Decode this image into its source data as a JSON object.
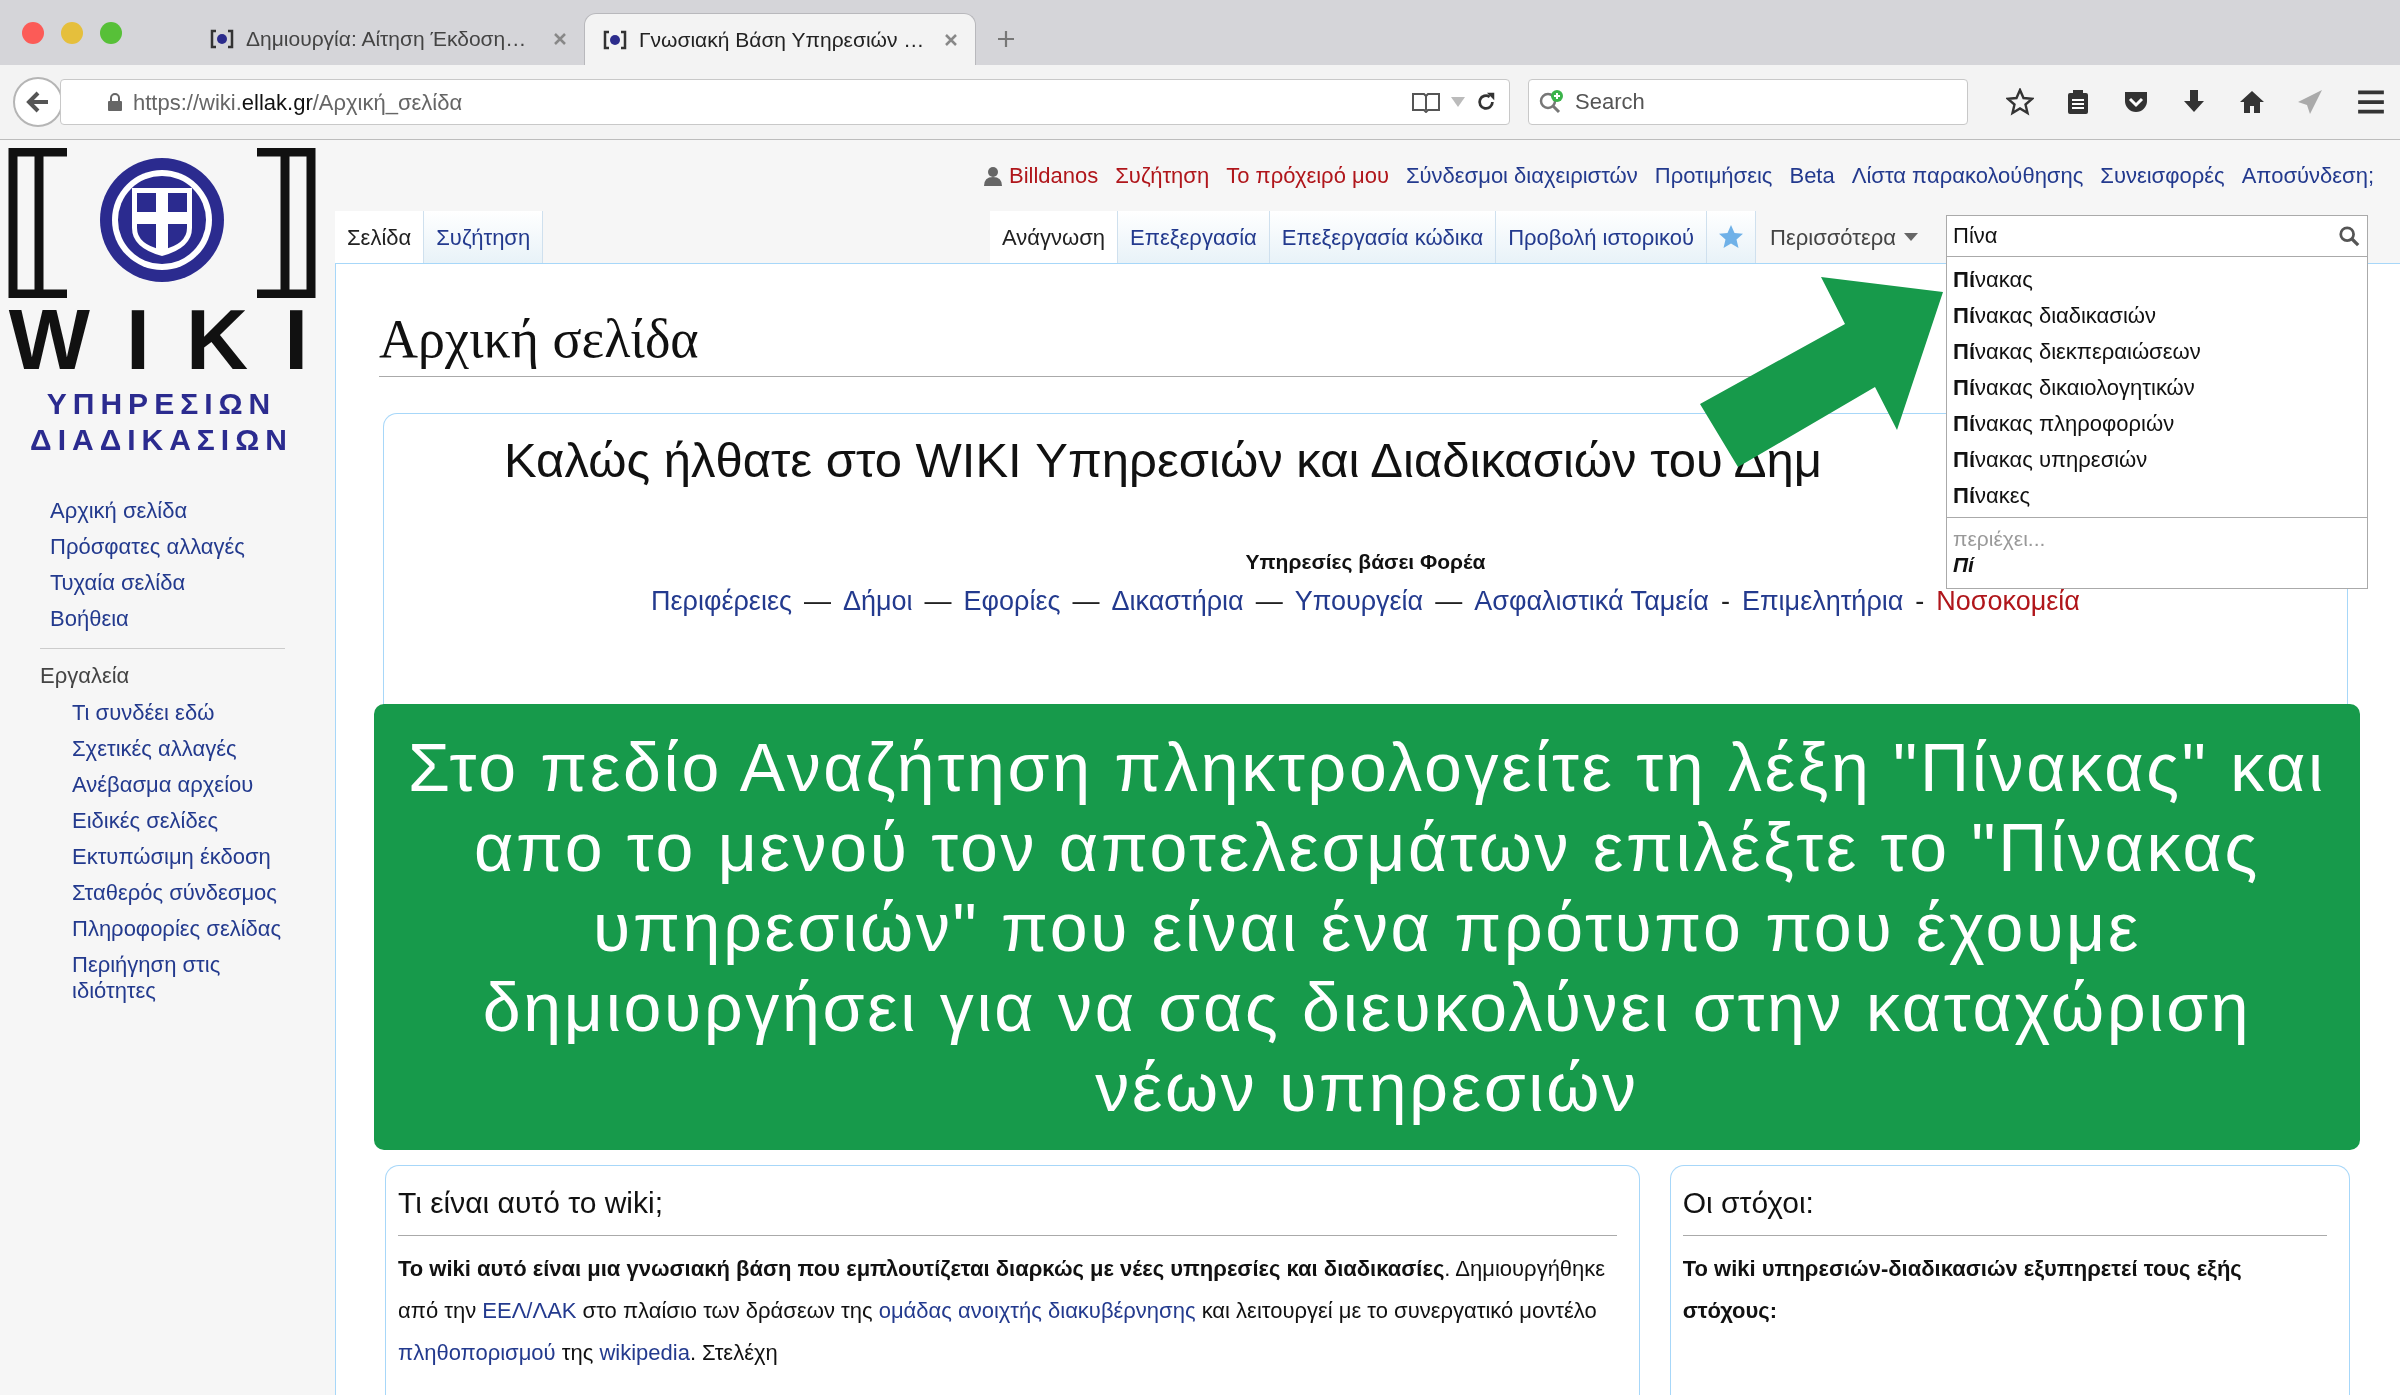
{
  "browser": {
    "tabs": [
      {
        "title": "Δημιουργία: Αίτηση Έκδοση…",
        "selected": false
      },
      {
        "title": "Γνωσιακή Βάση Υπηρεσιών …",
        "selected": true
      }
    ],
    "url_host": "https://wiki.",
    "url_domain": "ellak.gr",
    "url_path": "/Αρχική_σελίδα",
    "search_placeholder": "Search"
  },
  "logo": {
    "word": "WIKI",
    "line_1": "ΥΠΗΡΕΣΙΩΝ",
    "line_2": "ΔΙΑΔΙΚΑΣΙΩΝ"
  },
  "sidebar": {
    "navigation": [
      "Αρχική σελίδα",
      "Πρόσφατες αλλαγές",
      "Τυχαία σελίδα",
      "Βοήθεια"
    ],
    "tools_heading": "Εργαλεία",
    "tools": [
      "Τι συνδέει εδώ",
      "Σχετικές αλλαγές",
      "Ανέβασμα αρχείου",
      "Ειδικές σελίδες",
      "Εκτυπώσιμη έκδοση",
      "Σταθερός σύνδεσμος",
      "Πληροφορίες σελίδας",
      "Περιήγηση στις ιδιότητες"
    ]
  },
  "personal_links": [
    {
      "label": "Billdanos",
      "kind": "user",
      "missing": true
    },
    {
      "label": "Συζήτηση",
      "kind": "link",
      "missing": true
    },
    {
      "label": "Το πρόχειρό μου",
      "kind": "link",
      "missing": true
    },
    {
      "label": "Σύνδεσμοι διαχειριστών",
      "kind": "link",
      "missing": false
    },
    {
      "label": "Προτιμήσεις",
      "kind": "link",
      "missing": false
    },
    {
      "label": "Beta",
      "kind": "link",
      "missing": false
    },
    {
      "label": "Λίστα παρακολούθησης",
      "kind": "link",
      "missing": false
    },
    {
      "label": "Συνεισφορές",
      "kind": "link",
      "missing": false
    },
    {
      "label": "Αποσύνδεση;",
      "kind": "link",
      "missing": false
    }
  ],
  "namespace_tabs": [
    {
      "label": "Σελίδα",
      "selected": true
    },
    {
      "label": "Συζήτηση",
      "selected": false
    }
  ],
  "view_tabs": [
    {
      "label": "Ανάγνωση",
      "selected": true
    },
    {
      "label": "Επεξεργασία",
      "selected": false
    },
    {
      "label": "Επεξεργασία κώδικα",
      "selected": false
    },
    {
      "label": "Προβολή ιστορικού",
      "selected": false
    }
  ],
  "more_menu": "Περισσότερα",
  "search": {
    "value": "Πίνα",
    "suggestions": [
      "**Πί**νακας",
      "**Πί**νακας διαδικασιών",
      "**Πί**νακας διεκπεραιώσεων",
      "**Πί**νακας δικαιολογητικών",
      "**Πί**νακας πληροφοριών",
      "**Πί**νακας υπηρεσιών",
      "**Πί**νακες"
    ],
    "contains_label": "περιέχει...",
    "contains_value": "Πί"
  },
  "heading": "Αρχική σελίδα",
  "welcome": {
    "title": "Καλώς ήλθατε στο WIKI Υπηρεσιών και Διαδικασιών του Δημ",
    "subtitle": "Υπηρεσίες βάσει Φορέα",
    "links": [
      {
        "label": "Περιφέρειες",
        "missing": false,
        "separator": "—"
      },
      {
        "label": "Δήμοι",
        "missing": false,
        "separator": "—"
      },
      {
        "label": "Εφορίες",
        "missing": false,
        "separator": "—"
      },
      {
        "label": "Δικαστήρια",
        "missing": false,
        "separator": "—"
      },
      {
        "label": "Υπουργεία",
        "missing": false,
        "separator": "—"
      },
      {
        "label": "Ασφαλιστικά Ταμεία",
        "missing": false,
        "separator": "-"
      },
      {
        "label": "Επιμελητήρια",
        "missing": false,
        "separator": "-"
      },
      {
        "label": "Νοσοκομεία",
        "missing": true
      }
    ]
  },
  "annotation": "Στο πεδίο Αναζήτηση πληκτρολογείτε τη λέξη \"Πίνακας\" και απο το μενού τον αποτελεσμάτων επιλέξτε το \"Πίνακας υπηρεσιών\" που είναι ένα πρότυπο που έχουμε δημιουργήσει για να σας διευκολύνει στην καταχώριση νέων υπηρεσιών",
  "boxes": [
    {
      "title": "Τι είναι αυτό το wiki;",
      "paragraph": [
        {
          "kind": "bold",
          "text": "Το wiki αυτό είναι μια γνωσιακή βάση που εμπλουτίζεται διαρκώς με νέες υπηρεσίες και διαδικασίες"
        },
        {
          "kind": "text",
          "text": ". Δημιουργήθηκε από την "
        },
        {
          "kind": "link",
          "text": "ΕΕΛ/ΛΑΚ"
        },
        {
          "kind": "text",
          "text": " στο πλαίσιο των δράσεων της "
        },
        {
          "kind": "link",
          "text": "ομάδας ανοιχτής διακυβέρνησης"
        },
        {
          "kind": "text",
          "text": " και λειτουργεί με το συνεργατικό μοντέλο "
        },
        {
          "kind": "link",
          "text": "πληθοπορισμού"
        },
        {
          "kind": "text",
          "text": " της "
        },
        {
          "kind": "link",
          "text": "wikipedia"
        },
        {
          "kind": "text",
          "text": ". Στελέχη"
        }
      ]
    },
    {
      "title": "Οι στόχοι:",
      "paragraph": [
        {
          "kind": "bold",
          "text": "Το wiki υπηρεσιών-διαδικασιών εξυπηρετεί τους εξής στόχους:"
        }
      ]
    }
  ]
}
